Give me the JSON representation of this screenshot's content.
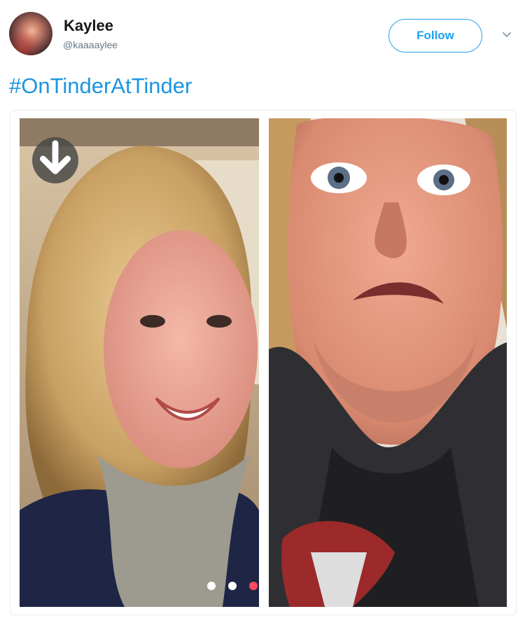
{
  "tweet": {
    "author": {
      "name": "Kaylee",
      "handle": "@kaaaaylee"
    },
    "follow_label": "Follow",
    "text": "#OnTinderAtTinder"
  },
  "media": {
    "photo_count": 2,
    "carousel": {
      "dots": 3,
      "active_index": 2
    }
  },
  "icons": {
    "menu": "chevron-down-icon",
    "download": "download-arrow-icon"
  },
  "colors": {
    "brand_blue": "#1da1f2",
    "hashtag_blue": "#1b95e0",
    "tinder_red": "#fe4a5e"
  }
}
